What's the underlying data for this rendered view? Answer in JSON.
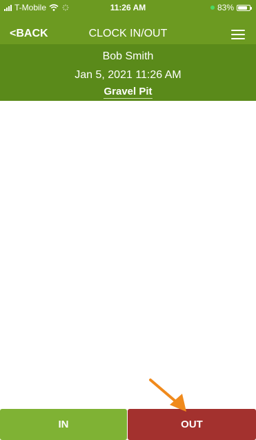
{
  "status_bar": {
    "carrier": "T-Mobile",
    "time": "11:26 AM",
    "battery": "83%",
    "battery_level": 0.83,
    "icons": [
      "signal-icon",
      "wifi-icon",
      "loading-icon",
      "charging-dot-icon",
      "battery-icon"
    ]
  },
  "nav": {
    "back_label": "<BACK",
    "title": "CLOCK IN/OUT",
    "menu_icon": "hamburger-menu-icon"
  },
  "info": {
    "user_name": "Bob Smith",
    "datetime": "Jan 5, 2021 11:26 AM",
    "location": "Gravel Pit"
  },
  "actions": {
    "in_label": "IN",
    "out_label": "OUT"
  },
  "colors": {
    "header_green": "#6c9a21",
    "info_green": "#5a8a1a",
    "in_green": "#7fb234",
    "out_red": "#a3312e",
    "arrow_orange": "#f08a1c"
  }
}
